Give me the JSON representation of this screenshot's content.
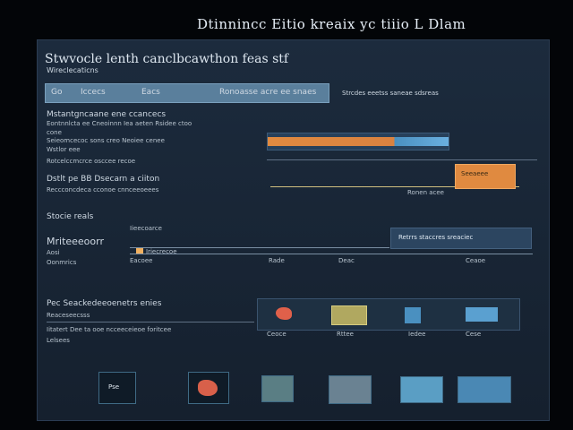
{
  "window": {
    "title": "Dtinnincc Eitio kreaix yc tiiio  L  Dlam"
  },
  "header": {
    "app_heading": "Stwvocle lenth canclbcawthon feas stf",
    "app_subheading": "Wireclecaticns",
    "toolbar": {
      "btn1": "Go",
      "btn2": "Iccecs",
      "btn3": "Eacs",
      "btn4": "Ronoasse acre ee snaes",
      "right_text": "Strcdes eeetss saneae sdsreas"
    }
  },
  "section1": {
    "title": "Mstantgncaane ene  ccancecs",
    "row1": "Eontnnlcta ee Cneoinnn Iea aeten Rsidee ctoo",
    "row2": "cone",
    "row3": "Seieomcecoc sons creo Neoiee cenee",
    "row4": "Wstlor eee",
    "row5": "Rotcelccmcrce osccee recoe",
    "progress1": 0.72,
    "progress2": 0.88
  },
  "section2": {
    "title": "Dstlt pe BB Dsecarn a ciiton",
    "subtitle": "Reccconcdeca cconoe cnnceeoeees",
    "card_label": "Seeaeee",
    "card_sub": "Ronen acee"
  },
  "section3": {
    "title": "Stocie reals",
    "chart_label1": "Mriteeeoorr",
    "chart_label2": "Aosi",
    "chart_label3": "Oonmrics",
    "legend1": "Iieecoarce",
    "legend2": "Iriecrecoe",
    "banner": "Retrrs staccres sreaciec",
    "axis": [
      "Eacoee",
      "Rade",
      "Deac",
      "Ceaoe"
    ]
  },
  "section4": {
    "title": "Pec Seackedeeoenetrs enies",
    "sub1": "Reaceseecsss",
    "sub2": "Iitatert Dee ta ooe ncceeceieoe foritcee",
    "sub3": "Lelsees",
    "captions": [
      "Ceoce",
      "Rttee",
      "Iedee",
      "Cese"
    ]
  },
  "footer": {
    "thumb1_text": "Pse"
  },
  "colors": {
    "orange": "#e08a40",
    "blue": "#4a90c0"
  }
}
